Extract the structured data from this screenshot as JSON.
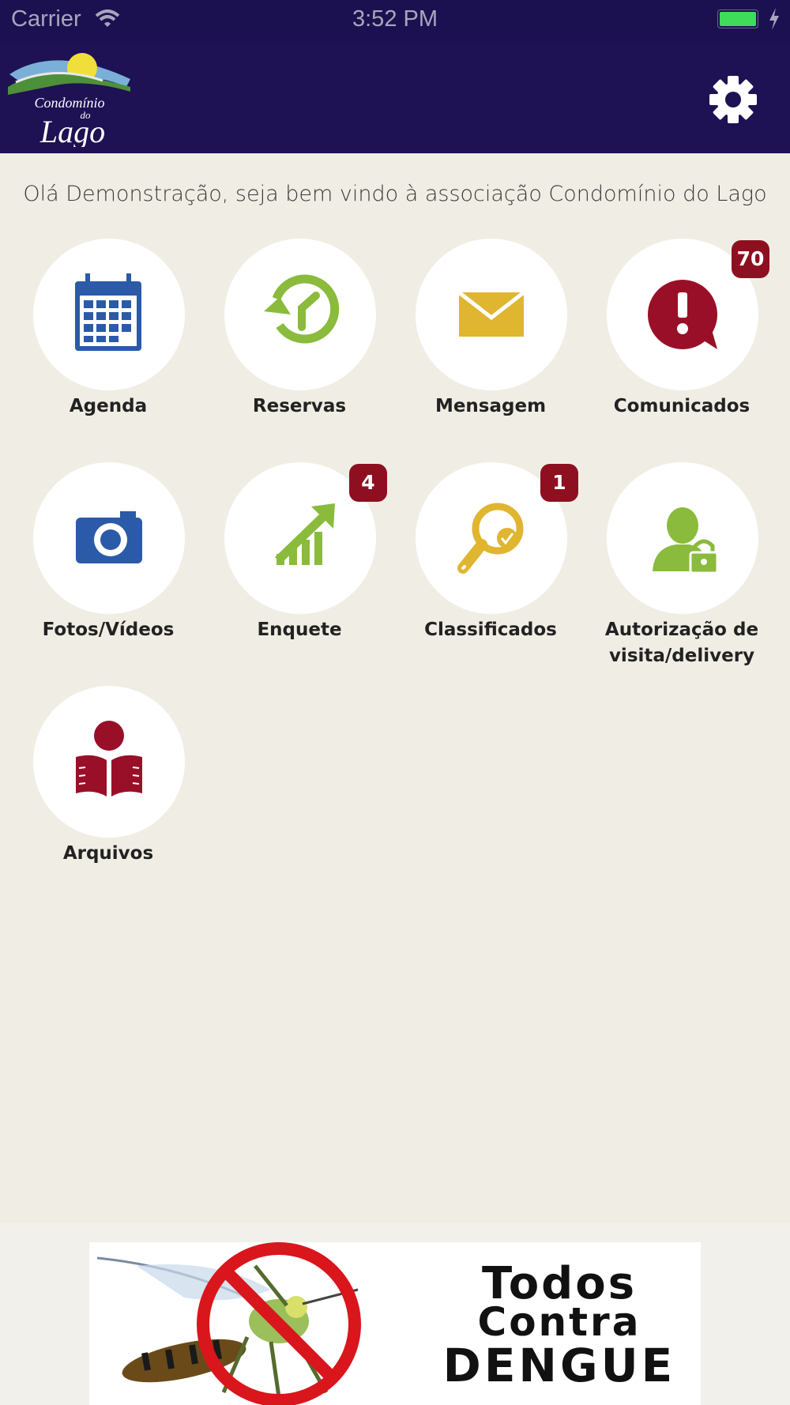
{
  "status_bar": {
    "carrier": "Carrier",
    "time": "3:52 PM"
  },
  "header": {
    "logo_text_line1": "Condomínio",
    "logo_text_line2": "do",
    "logo_text_line3": "Lago"
  },
  "welcome_message": "Olá Demonstração, seja bem vindo à associação Condomínio do Lago",
  "menu": [
    {
      "id": "agenda",
      "label": "Agenda",
      "icon": "calendar-icon",
      "color": "#2b5aa8",
      "badge": ""
    },
    {
      "id": "reservas",
      "label": "Reservas",
      "icon": "clock-refresh-icon",
      "color": "#8abb3c",
      "badge": ""
    },
    {
      "id": "mensagem",
      "label": "Mensagem",
      "icon": "envelope-icon",
      "color": "#e0b530",
      "badge": ""
    },
    {
      "id": "comunicados",
      "label": "Comunicados",
      "icon": "alert-bubble-icon",
      "color": "#9a0f28",
      "badge": "70"
    },
    {
      "id": "fotos",
      "label": "Fotos/Vídeos",
      "icon": "camera-icon",
      "color": "#2b5aa8",
      "badge": ""
    },
    {
      "id": "enquete",
      "label": "Enquete",
      "icon": "growth-chart-icon",
      "color": "#8abb3c",
      "badge": "4"
    },
    {
      "id": "classificados",
      "label": "Classificados",
      "icon": "search-check-icon",
      "color": "#e0b530",
      "badge": "1"
    },
    {
      "id": "autorizacao",
      "label_line1": "Autorização de",
      "label_line2": "visita/delivery",
      "icon": "person-lock-icon",
      "color": "#8abb3c",
      "badge": ""
    },
    {
      "id": "arquivos",
      "label": "Arquivos",
      "icon": "reader-book-icon",
      "color": "#9a0f28",
      "badge": ""
    }
  ],
  "ad": {
    "line1": "Todos",
    "line2": "Contra",
    "line3": "DENGUE"
  }
}
